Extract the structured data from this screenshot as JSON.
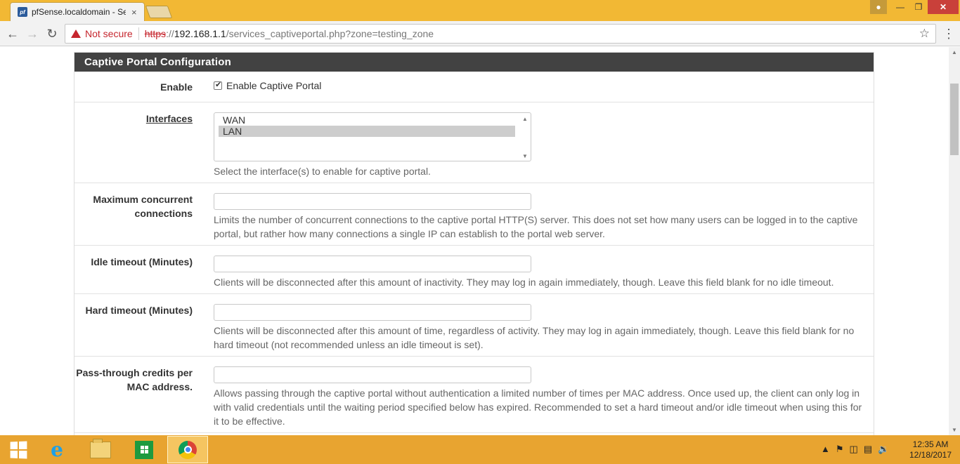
{
  "browser": {
    "tab_title": "pfSense.localdomain - Se",
    "tab_favicon": "pf",
    "tab_close": "×",
    "not_secure": "Not secure",
    "url_https": "https",
    "url_sep": "://",
    "url_host": "192.168.1.1",
    "url_path": "/services_captiveportal.php?zone=testing_zone",
    "icons": [
      "back-icon",
      "forward-icon",
      "reload-icon",
      "warning-icon",
      "star-icon",
      "menu-icon"
    ]
  },
  "panel": {
    "title": "Captive Portal Configuration",
    "enable": {
      "label": "Enable",
      "checkbox_label": "Enable Captive Portal",
      "checked": true
    },
    "interfaces": {
      "label": "Interfaces",
      "options": [
        "WAN",
        "LAN"
      ],
      "selected": "LAN",
      "help": "Select the interface(s) to enable for captive portal."
    },
    "max_conn": {
      "label_line1": "Maximum concurrent",
      "label_line2": "connections",
      "value": "",
      "help_line1": "Limits the number of concurrent connections to the captive portal HTTP(S) server. This does not set how many users can be logged in to the captive",
      "help_line2": "portal, but rather how many connections a single IP can establish to the portal web server."
    },
    "idle_timeout": {
      "label": "Idle timeout (Minutes)",
      "value": "",
      "help": "Clients will be disconnected after this amount of inactivity. They may log in again immediately, though. Leave this field blank for no idle timeout."
    },
    "hard_timeout": {
      "label": "Hard timeout (Minutes)",
      "value": "",
      "help_line1": "Clients will be disconnected after this amount of time, regardless of activity. They may log in again immediately, though. Leave this field blank for no",
      "help_line2": "hard timeout (not recommended unless an idle timeout is set)."
    },
    "passthrough": {
      "label_line1": "Pass-through credits per",
      "label_line2": "MAC address.",
      "value": "",
      "help_line1": "Allows passing through the captive portal without authentication a limited number of times per MAC address. Once used up, the client can only log in",
      "help_line2": "with valid credentials until the waiting period specified below has expired. Recommended to set a hard timeout and/or idle timeout when using this for",
      "help_line3": "it to be effective."
    }
  },
  "taskbar": {
    "apps": [
      "windows-start",
      "internet-explorer",
      "file-explorer",
      "windows-store",
      "chrome"
    ],
    "time": "12:35 AM",
    "date": "12/18/2017"
  },
  "colors": {
    "titlebar": "#f2b834",
    "taskbar": "#e8a430",
    "panel_heading": "#424242",
    "warning": "#c6262e"
  }
}
